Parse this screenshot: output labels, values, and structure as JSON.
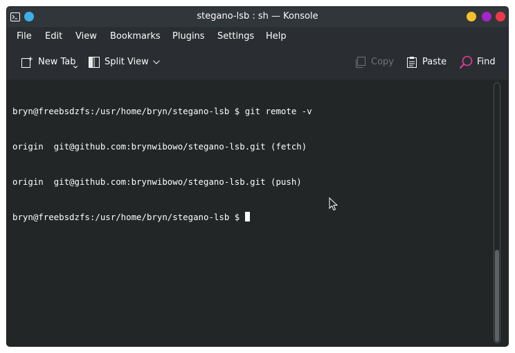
{
  "window": {
    "title": "stegano-lsb : sh — Konsole"
  },
  "menubar": {
    "items": [
      "File",
      "Edit",
      "View",
      "Bookmarks",
      "Plugins",
      "Settings",
      "Help"
    ]
  },
  "toolbar": {
    "new_tab_label": "New Tab",
    "split_view_label": "Split View",
    "copy_label": "Copy",
    "paste_label": "Paste",
    "find_label": "Find"
  },
  "terminal": {
    "lines": [
      "bryn@freebsdzfs:/usr/home/bryn/stegano-lsb $ git remote -v",
      "origin  git@github.com:brynwibowo/stegano-lsb.git (fetch)",
      "origin  git@github.com:brynwibowo/stegano-lsb.git (push)",
      "bryn@freebsdzfs:/usr/home/bryn/stegano-lsb $ "
    ]
  },
  "colors": {
    "accent": "#3daee9",
    "minimize": "#f7c12b",
    "maximize": "#a624c8",
    "close": "#eb3a47",
    "find_icon": "#e93d95"
  }
}
